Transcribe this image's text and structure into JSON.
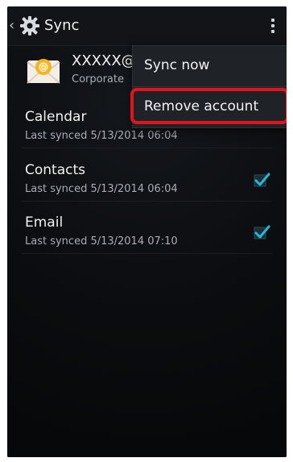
{
  "actionbar": {
    "title": "Sync",
    "back_icon": "chevron-left-icon",
    "settings_icon": "gear-icon",
    "overflow_icon": "overflow-menu-icon"
  },
  "account": {
    "name": "XXXXX@",
    "type": "Corporate",
    "icon": "mail-envelope-icon"
  },
  "sync_items": [
    {
      "label": "Calendar",
      "last_synced": "Last synced 5/13/2014 06:04",
      "checked": true
    },
    {
      "label": "Contacts",
      "last_synced": "Last synced 5/13/2014 06:04",
      "checked": true
    },
    {
      "label": "Email",
      "last_synced": "Last synced 5/13/2014 07:10",
      "checked": true
    }
  ],
  "menu": {
    "items": [
      {
        "label": "Sync now"
      },
      {
        "label": "Remove account"
      }
    ]
  },
  "colors": {
    "accent_check": "#25b8d6",
    "highlight": "#e1141b",
    "background": "#0b0d10"
  }
}
